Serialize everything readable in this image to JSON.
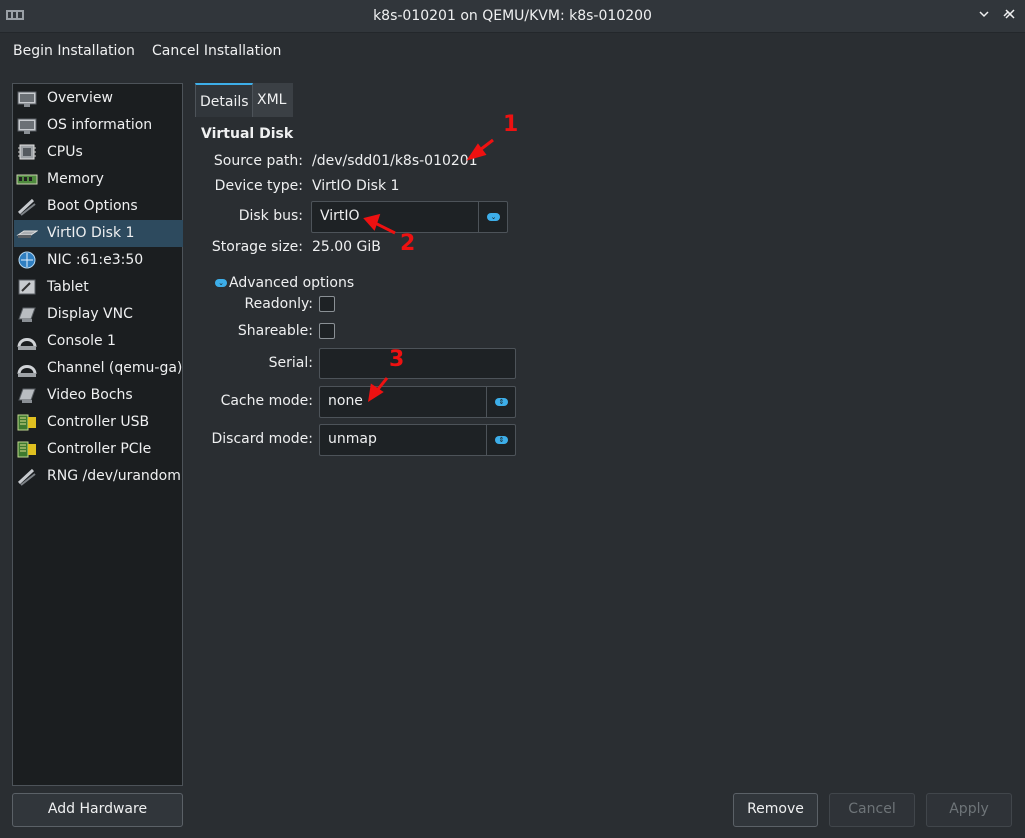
{
  "window": {
    "title": "k8s-010201 on QEMU/KVM: k8s-010200",
    "app_icon": "virt-manager-icon",
    "controls": [
      "chevron-down-icon",
      "chevron-up-icon",
      "close-icon"
    ]
  },
  "menubar": {
    "begin": "Begin Installation",
    "cancel": "Cancel Installation"
  },
  "sidebar": {
    "items": [
      {
        "label": "Overview",
        "icon": "monitor-icon"
      },
      {
        "label": "OS information",
        "icon": "monitor-icon"
      },
      {
        "label": "CPUs",
        "icon": "cpu-icon"
      },
      {
        "label": "Memory",
        "icon": "memory-icon"
      },
      {
        "label": "Boot Options",
        "icon": "boot-options-icon"
      },
      {
        "label": "VirtIO Disk 1",
        "icon": "disk-icon"
      },
      {
        "label": "NIC :61:e3:50",
        "icon": "network-icon"
      },
      {
        "label": "Tablet",
        "icon": "tablet-icon"
      },
      {
        "label": "Display VNC",
        "icon": "display-icon"
      },
      {
        "label": "Console 1",
        "icon": "console-icon"
      },
      {
        "label": "Channel (qemu-ga)",
        "icon": "channel-icon"
      },
      {
        "label": "Video Bochs",
        "icon": "video-icon"
      },
      {
        "label": "Controller USB",
        "icon": "controller-icon"
      },
      {
        "label": "Controller PCIe",
        "icon": "controller-icon"
      },
      {
        "label": "RNG /dev/urandom",
        "icon": "rng-icon"
      }
    ],
    "selected": "VirtIO Disk 1"
  },
  "buttons": {
    "add_hardware": "Add Hardware",
    "remove": "Remove",
    "cancel": "Cancel",
    "apply": "Apply"
  },
  "tabs": {
    "details": "Details",
    "xml": "XML"
  },
  "details": {
    "heading": "Virtual Disk",
    "source_path_label": "Source path:",
    "source_path_value": "/dev/sdd01/k8s-010201",
    "device_type_label": "Device type:",
    "device_type_value": "VirtIO Disk 1",
    "disk_bus_label": "Disk bus:",
    "disk_bus_value": "VirtIO",
    "storage_size_label": "Storage size:",
    "storage_size_value": "25.00 GiB",
    "advanced_label": "Advanced options",
    "readonly_label": "Readonly:",
    "shareable_label": "Shareable:",
    "serial_label": "Serial:",
    "serial_value": "",
    "cache_mode_label": "Cache mode:",
    "cache_mode_value": "none",
    "discard_mode_label": "Discard mode:",
    "discard_mode_value": "unmap"
  },
  "annotations": {
    "one": "1",
    "two": "2",
    "three": "3",
    "color": "#ee1111"
  },
  "colors": {
    "accent": "#3daee9",
    "selection": "#2d4a5e",
    "background": "#2a2e32"
  }
}
